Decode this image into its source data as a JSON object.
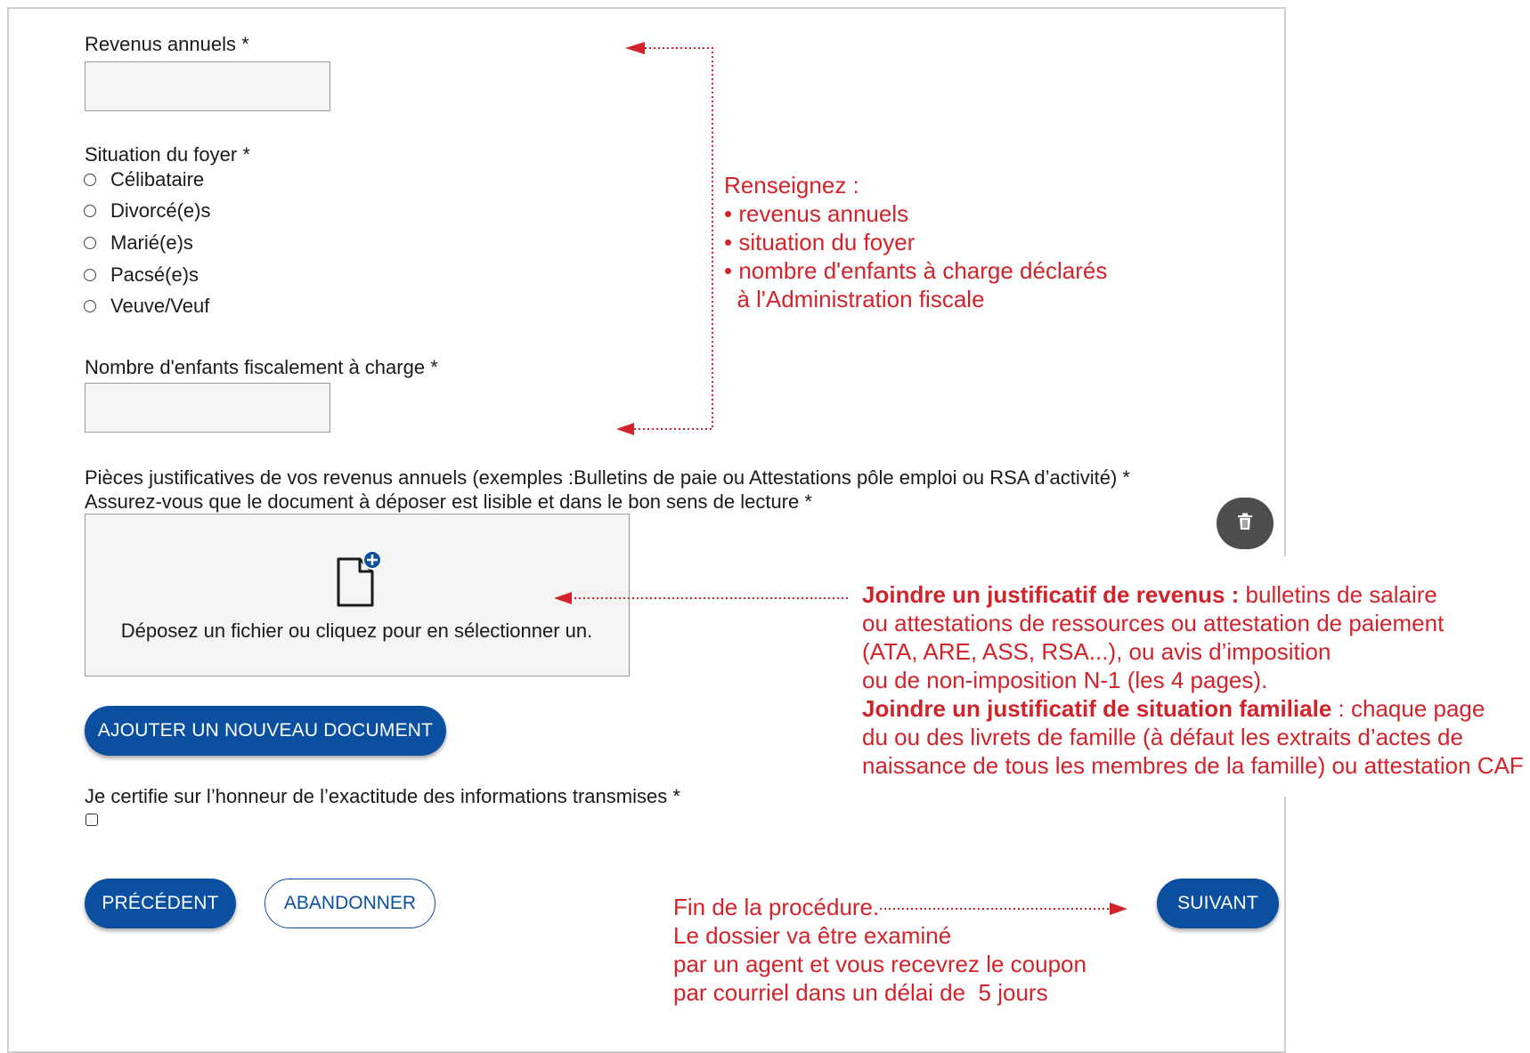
{
  "form": {
    "annual_income_label": "Revenus annuels",
    "household_label": "Situation du foyer",
    "household_options": [
      "Célibataire",
      "Divorcé(e)s",
      "Marié(e)s",
      "Pacsé(e)s",
      "Veuve/Veuf"
    ],
    "children_label": "Nombre d'enfants fiscalement à charge",
    "documents_label": "Pièces justificatives de vos revenus annuels (exemples :Bulletins de paie ou Attestations pôle emploi ou RSA d’activité)",
    "documents_hint": "Assurez-vous que le document à déposer est lisible et dans le bon sens de lecture",
    "dropzone_text": "Déposez un fichier ou cliquez pour en sélectionner un.",
    "add_document_button": "AJOUTER UN NOUVEAU DOCUMENT",
    "certify_label": "Je certifie sur l’honneur de l’exactitude des informations transmises",
    "required_marker": "*",
    "previous_button": "PRÉCÉDENT",
    "abandon_button": "ABANDONNER",
    "next_button": "SUIVANT",
    "icons": {
      "delete": "trash-icon",
      "upload": "file-add-icon",
      "radio": "radio-empty",
      "checkbox": "checkbox-empty"
    }
  },
  "annotations": {
    "fill_in": {
      "title": "Renseignez :",
      "items": [
        "• revenus annuels",
        "• situation du foyer",
        "• nombre d'enfants à charge déclarés",
        "  à l'Administration fiscale"
      ]
    },
    "documents": {
      "income_bold": "Joindre un justificatif de revenus :",
      "income_text_1": " bulletins de salaire",
      "income_lines": [
        "ou attestations de ressources ou attestation de paiement",
        "(ATA, ARE, ASS, RSA...), ou avis d’imposition",
        "ou de non-imposition N-1 (les 4 pages)."
      ],
      "family_bold": "Joindre un justificatif de situation familiale",
      "family_text_1": " : chaque page",
      "family_lines": [
        "du ou des livrets de famille (à défaut les extraits d’actes de",
        "naissance de tous les membres de la famille) ou attestation CAF"
      ]
    },
    "end": {
      "lines": [
        "Fin de la procédure.",
        "Le dossier va être examiné",
        "par un agent et vous recevrez le coupon",
        "par courriel dans un délai de  5 jours"
      ]
    }
  },
  "colors": {
    "primary": "#0b4fa1",
    "annotation": "#d2232a",
    "field_bg": "#f4f4f4",
    "trash_bg": "#4d4d4d"
  }
}
